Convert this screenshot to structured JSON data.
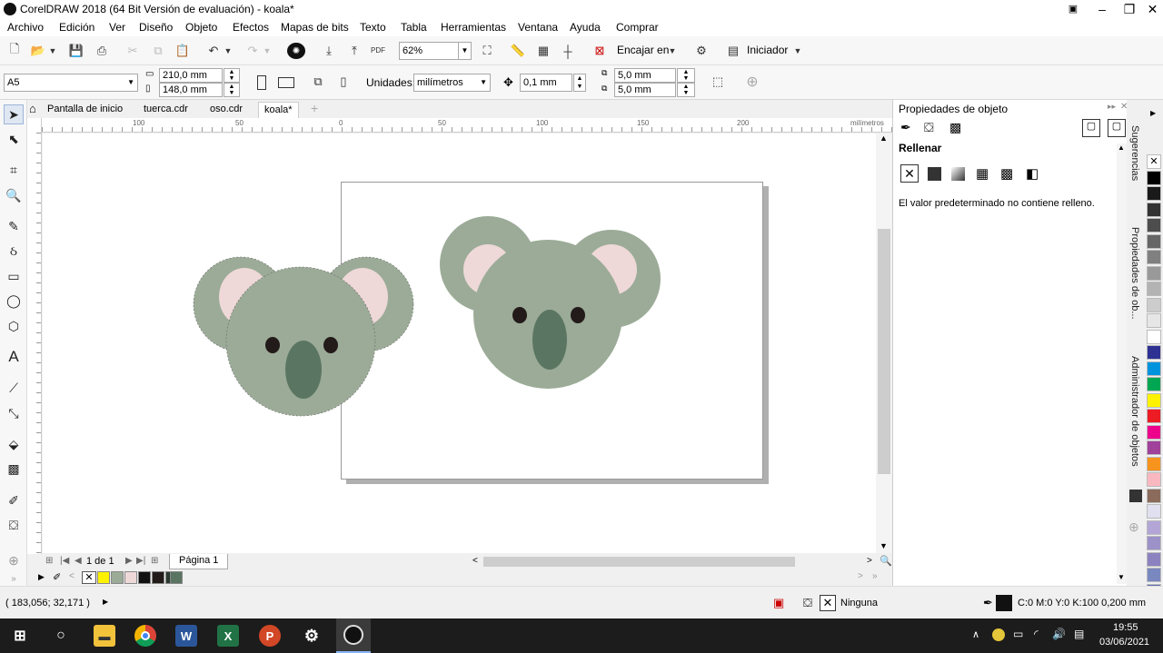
{
  "window": {
    "title": "CorelDRAW 2018 (64 Bit Versión de evaluación) - koala*"
  },
  "menu": [
    "Archivo",
    "Edición",
    "Ver",
    "Diseño",
    "Objeto",
    "Efectos",
    "Mapas de bits",
    "Texto",
    "Tabla",
    "Herramientas",
    "Ventana",
    "Ayuda",
    "Comprar"
  ],
  "standard": {
    "zoom": "62%",
    "snap_label": "Encajar en",
    "launch_label": "Iniciador",
    "pdf_label": "PDF"
  },
  "property_bar": {
    "page_size": "A5",
    "width": "210,0 mm",
    "height": "148,0 mm",
    "units_label": "Unidades:",
    "units_value": "milímetros",
    "nudge": "0,1 mm",
    "dup_x": "5,0 mm",
    "dup_y": "5,0 mm"
  },
  "doc_tabs": [
    "Pantalla de inicio",
    "tuerca.cdr",
    "oso.cdr",
    "koala*"
  ],
  "ruler": {
    "unit": "milímetros",
    "h_labels": [
      "100",
      "50",
      "0",
      "50",
      "100",
      "150",
      "200"
    ]
  },
  "page_nav": {
    "counter": "1 de 1",
    "page_tab": "Página 1"
  },
  "docker": {
    "title": "Propiedades de objeto",
    "section": "Rellenar",
    "message": "El valor predeterminado no contiene relleno."
  },
  "docker_tabs": {
    "hints": "Sugerencias",
    "object_props": "Propiedades de ob...",
    "object_manager": "Administrador de objetos"
  },
  "status": {
    "coords": "( 183,056; 32,171 )",
    "fill_label": "Ninguna",
    "outline": "C:0 M:0 Y:0 K:100  0,200 mm"
  },
  "taskbar": {
    "time": "19:55",
    "date": "03/06/2021"
  },
  "colors": {
    "koala_fur": "#9bab97",
    "koala_ear": "#eed8d8",
    "koala_nose": "#5a7562",
    "koala_eye": "#231a1a"
  },
  "palette": [
    "#ffffff",
    "#000000",
    "#1a1a1a",
    "#333333",
    "#4d4d4d",
    "#666666",
    "#808080",
    "#999999",
    "#b3b3b3",
    "#cccccc",
    "#e6e6e6",
    "#ffffff",
    "#2e3192",
    "#0093dd",
    "#00a651",
    "#fff200",
    "#ed1c24",
    "#ec008c",
    "#a0419a",
    "#f7941d",
    "#f9b8c0",
    "#8b6b5b",
    "#e0e0f0",
    "#b3a6d6",
    "#9c92c8",
    "#8c82c0",
    "#7a88c0",
    "#5f6fb0"
  ]
}
